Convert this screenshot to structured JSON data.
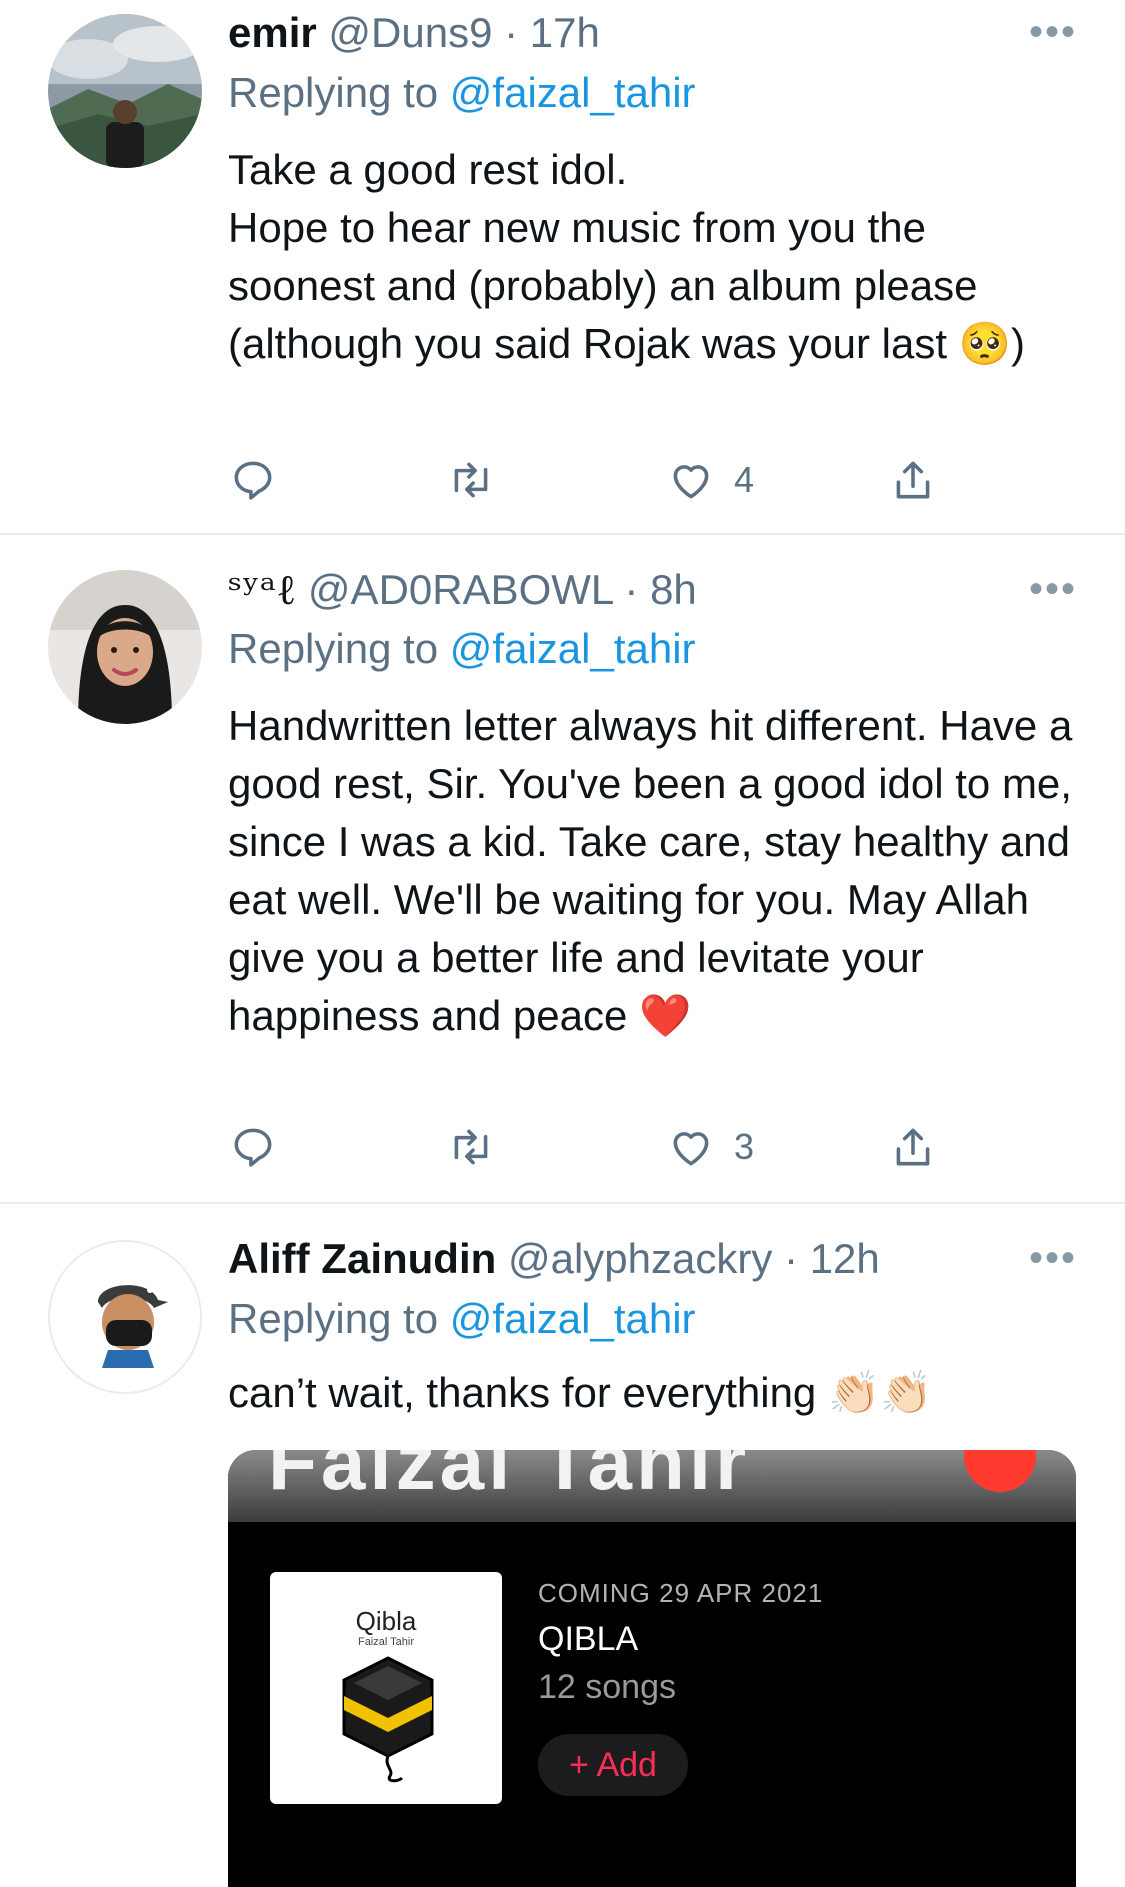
{
  "tweets": [
    {
      "name": "emir",
      "handle": "@Duns9",
      "sep": "·",
      "time": "17h",
      "reply_prefix": "Replying to ",
      "reply_to": "@faizal_tahir",
      "body": "Take a good rest idol.\nHope to hear new music from you the soonest and (probably) an album please (although you said Rojak was your last 🥺)",
      "like_count": "4",
      "more": "•••"
    },
    {
      "name": "ˢʸᵃℓ",
      "handle": "@AD0RABOWL",
      "sep": "·",
      "time": "8h",
      "reply_prefix": "Replying to ",
      "reply_to": "@faizal_tahir",
      "body": "Handwritten letter always hit different. Have a good rest, Sir. You've been a good idol to me, since I was a kid. Take care, stay healthy and eat well. We'll be waiting for you. May Allah give you a better life and levitate your happiness and peace ❤️",
      "like_count": "3",
      "more": "•••"
    },
    {
      "name": "Aliff Zainudin",
      "handle": "@alyphzackry",
      "sep": "·",
      "time": "12h",
      "reply_prefix": "Replying to ",
      "reply_to": "@faizal_tahir",
      "body": "can’t wait, thanks for everything 👏🏻👏🏻",
      "more": "•••"
    }
  ],
  "card": {
    "banner_text": "Faizal Tahir",
    "cover_title": "Qibla",
    "cover_artist": "Faizal Tahir",
    "coming": "COMING 29 APR 2021",
    "album_name": "QIBLA",
    "song_count": "12 songs",
    "add_label": "+ Add"
  },
  "icons": {
    "reply": "reply-icon",
    "retweet": "retweet-icon",
    "like": "heart-icon",
    "share": "share-icon"
  },
  "colors": {
    "link": "#1b95e0",
    "secondary": "#5b7083",
    "divider": "#e6ecf0",
    "apple_music_red": "#ff2d55"
  }
}
